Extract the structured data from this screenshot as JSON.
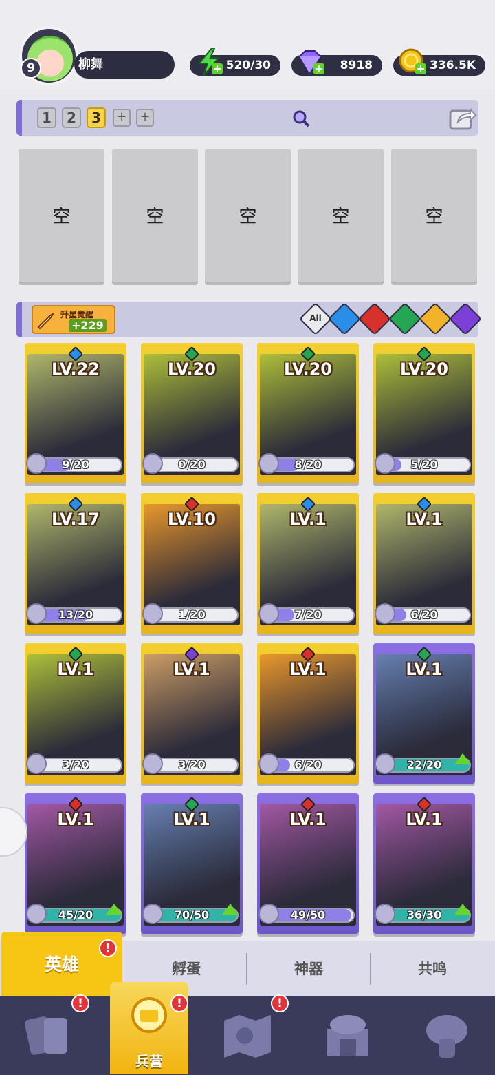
{
  "player": {
    "name": "柳舞",
    "level": "9"
  },
  "resources": {
    "energy": "520/30",
    "gems": "8918",
    "gold": "336.5K"
  },
  "teams": {
    "tabs": [
      "1",
      "2",
      "3"
    ],
    "active": "3",
    "add": "+"
  },
  "slots": [
    "空",
    "空",
    "空",
    "空",
    "空"
  ],
  "star_awaken": {
    "label": "升星觉醒",
    "value": "+229"
  },
  "filters": {
    "all": "All",
    "elements": [
      "water",
      "fire",
      "nature",
      "light",
      "dark"
    ]
  },
  "element_colors": {
    "water": "#2a8ee8",
    "fire": "#d8302a",
    "nature": "#24a653",
    "light": "#f2b32a",
    "dark": "#7c3fd8"
  },
  "heroes": [
    {
      "level": "LV.22",
      "element": "water",
      "shards": "9/20",
      "progress": 0.45,
      "frame": "gold"
    },
    {
      "level": "LV.20",
      "element": "nature",
      "shards": "0/20",
      "progress": 0.0,
      "frame": "gold"
    },
    {
      "level": "LV.20",
      "element": "nature",
      "shards": "8/20",
      "progress": 0.4,
      "frame": "gold"
    },
    {
      "level": "LV.20",
      "element": "nature",
      "shards": "5/20",
      "progress": 0.25,
      "frame": "gold"
    },
    {
      "level": "LV.17",
      "element": "water",
      "shards": "13/20",
      "progress": 0.65,
      "frame": "gold"
    },
    {
      "level": "LV.10",
      "element": "fire",
      "shards": "1/20",
      "progress": 0.05,
      "frame": "gold"
    },
    {
      "level": "LV.1",
      "element": "water",
      "shards": "7/20",
      "progress": 0.35,
      "frame": "gold"
    },
    {
      "level": "LV.1",
      "element": "water",
      "shards": "6/20",
      "progress": 0.3,
      "frame": "gold"
    },
    {
      "level": "LV.1",
      "element": "nature",
      "shards": "3/20",
      "progress": 0.15,
      "frame": "gold"
    },
    {
      "level": "LV.1",
      "element": "dark",
      "shards": "3/20",
      "progress": 0.15,
      "frame": "gold"
    },
    {
      "level": "LV.1",
      "element": "fire",
      "shards": "6/20",
      "progress": 0.3,
      "frame": "gold"
    },
    {
      "level": "LV.1",
      "element": "nature",
      "shards": "22/20",
      "progress": 1.0,
      "frame": "purple",
      "upgrade": true
    },
    {
      "level": "LV.1",
      "element": "fire",
      "shards": "45/20",
      "progress": 1.0,
      "frame": "purple",
      "upgrade": true
    },
    {
      "level": "LV.1",
      "element": "nature",
      "shards": "70/50",
      "progress": 1.0,
      "frame": "purple",
      "upgrade": true
    },
    {
      "level": "LV.1",
      "element": "fire",
      "shards": "49/50",
      "progress": 0.98,
      "frame": "purple"
    },
    {
      "level": "LV.1",
      "element": "fire",
      "shards": "36/30",
      "progress": 1.0,
      "frame": "purple",
      "upgrade": true
    }
  ],
  "subtabs": [
    "英雄",
    "孵蛋",
    "神器",
    "共鸣"
  ],
  "nav": {
    "active_label": "兵营",
    "alert": "!"
  }
}
